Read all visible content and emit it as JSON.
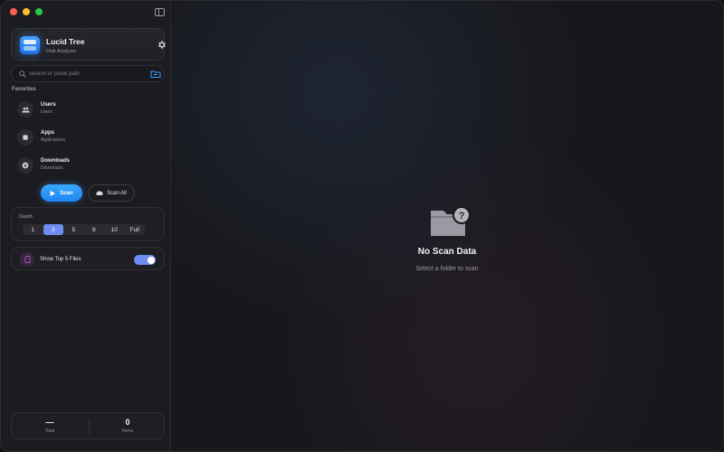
{
  "app": {
    "name": "Lucid Tree",
    "subtitle": "Disk Analyzer"
  },
  "search": {
    "placeholder": "Search or paste path"
  },
  "favorites": {
    "header": "Favorites",
    "items": [
      {
        "name": "Users",
        "path": "Users",
        "icon": "users-icon"
      },
      {
        "name": "Apps",
        "path": "Applications",
        "icon": "apps-icon"
      },
      {
        "name": "Downloads",
        "path": "Downloads",
        "icon": "download-icon"
      }
    ]
  },
  "actions": {
    "scan_label": "Scan",
    "scan_all_label": "Scan All"
  },
  "depth": {
    "label": "Depth",
    "options": [
      "1",
      "3",
      "5",
      "8",
      "10",
      "Full"
    ],
    "selected": "3"
  },
  "top_files": {
    "label": "Show Top 5 Files",
    "enabled": true
  },
  "stats": {
    "total_value": "—",
    "total_label": "Total",
    "items_value": "0",
    "items_label": "Items"
  },
  "empty_state": {
    "title": "No Scan Data",
    "subtitle": "Select a folder to scan"
  },
  "colors": {
    "accent": "#2b93f7",
    "selection": "#6e8ef2",
    "close": "#ff5f57",
    "minimize": "#febc2e",
    "zoom": "#28c840"
  }
}
